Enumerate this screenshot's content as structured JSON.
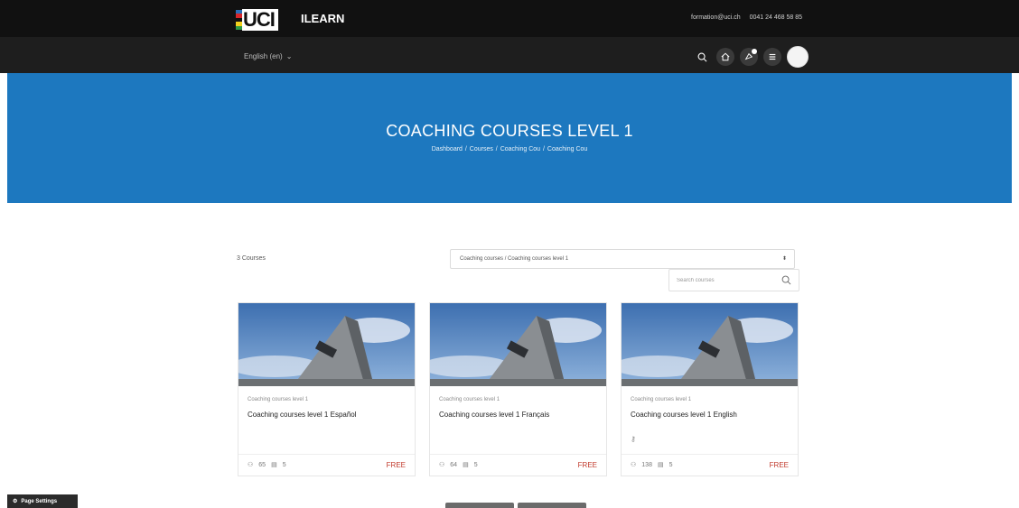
{
  "header": {
    "brand_logo": "UCI",
    "brand_text": "ILEARN",
    "email": "formation@uci.ch",
    "phone": "0041 24 468 58 85"
  },
  "nav": {
    "language": "English (en)",
    "icons": [
      "search-icon",
      "home-icon",
      "notifications-icon",
      "menu-icon",
      "avatar"
    ]
  },
  "hero": {
    "title": "COACHING COURSES LEVEL 1",
    "breadcrumb": [
      "Dashboard",
      "Courses",
      "Coaching Cou",
      "Coaching Cou"
    ],
    "background": "#1d78bf"
  },
  "filters": {
    "count_label": "3 Courses",
    "category_select": "Coaching courses / Coaching courses level 1",
    "search_placeholder": "Search courses"
  },
  "courses": [
    {
      "category": "Coaching courses level 1",
      "title": "Coaching courses level 1 Español",
      "participants": "65",
      "lessons": "5",
      "price": "FREE",
      "has_key": false
    },
    {
      "category": "Coaching courses level 1",
      "title": "Coaching courses level 1 Français",
      "participants": "64",
      "lessons": "5",
      "price": "FREE",
      "has_key": false
    },
    {
      "category": "Coaching courses level 1",
      "title": "Coaching courses level 1 English",
      "participants": "138",
      "lessons": "5",
      "price": "FREE",
      "has_key": true
    }
  ],
  "page_settings_label": "Page Settings",
  "colors": {
    "accent": "#1d78bf",
    "price": "#c0392b",
    "topbar": "#111111"
  }
}
